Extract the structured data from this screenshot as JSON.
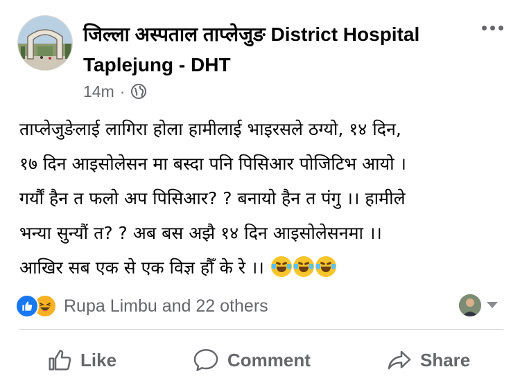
{
  "post": {
    "author": "जिल्ला अस्पताल ताप्लेजुङ District Hospital Taplejung - DHT",
    "timestamp": "14m",
    "separator": "·",
    "audience_icon": "globe-icon",
    "text_lines": [
      "ताप्लेजुङेलाई लागिरा होला हामीलाई भाइरसले ठग्यो, १४ दिन,",
      "१७ दिन आइसोलेसन मा बस्दा पनि पिसिआर पोजिटिभ आयो ।",
      "गर्यौं हैन त फलो अप पिसिआर? ?  बनायो हैन त पंगु ।। हामीले",
      "भन्या सुन्यौं त? ?  अब बस अझै १४ दिन आइसोलेसनमा ।।",
      "आखिर सब एक से एक विज्ञ हौँ के रे ।।"
    ],
    "trailing_emojis": [
      "laughing-tears-emoji",
      "laughing-tears-emoji",
      "laughing-tears-emoji"
    ]
  },
  "reactions": {
    "icons": [
      "like-reaction-icon",
      "haha-reaction-icon"
    ],
    "summary": "Rupa Limbu and 22 others"
  },
  "actions": {
    "like_label": "Like",
    "comment_label": "Comment",
    "share_label": "Share"
  },
  "colors": {
    "text": "#050505",
    "secondary": "#65676b",
    "like_blue": "#1877f2",
    "haha_yellow": "#f7b125"
  }
}
